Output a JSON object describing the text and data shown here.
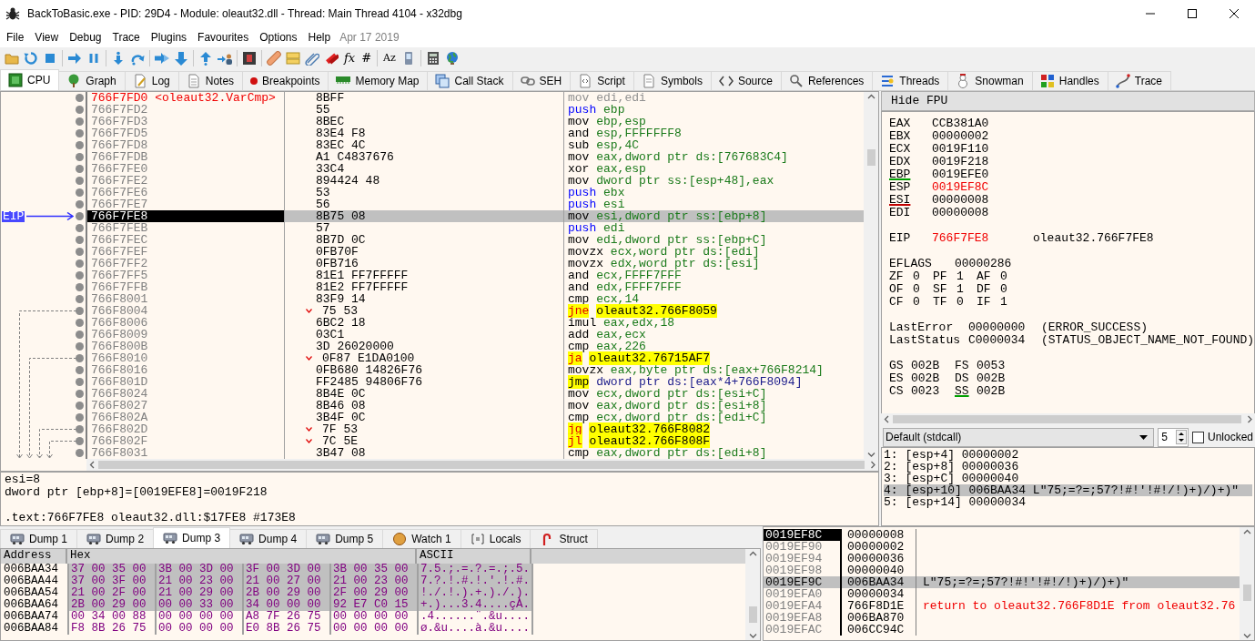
{
  "window": {
    "title": "BackToBasic.exe - PID: 29D4 - Module: oleaut32.dll - Thread: Main Thread 4104 - x32dbg"
  },
  "menu": {
    "items": [
      "File",
      "View",
      "Debug",
      "Trace",
      "Plugins",
      "Favourites",
      "Options",
      "Help"
    ],
    "build_date": "Apr 17 2019"
  },
  "toolbar": {
    "glyphs": [
      "fx",
      "#",
      "Az"
    ]
  },
  "tabs": [
    {
      "label": "CPU",
      "selected": true
    },
    {
      "label": "Graph",
      "selected": false
    },
    {
      "label": "Log",
      "selected": false
    },
    {
      "label": "Notes",
      "selected": false
    },
    {
      "label": "Breakpoints",
      "selected": false
    },
    {
      "label": "Memory Map",
      "selected": false
    },
    {
      "label": "Call Stack",
      "selected": false
    },
    {
      "label": "SEH",
      "selected": false
    },
    {
      "label": "Script",
      "selected": false
    },
    {
      "label": "Symbols",
      "selected": false
    },
    {
      "label": "Source",
      "selected": false
    },
    {
      "label": "References",
      "selected": false
    },
    {
      "label": "Threads",
      "selected": false
    },
    {
      "label": "Snowman",
      "selected": false
    },
    {
      "label": "Handles",
      "selected": false
    },
    {
      "label": "Trace",
      "selected": false
    }
  ],
  "disasm": {
    "eip_label": "EIP",
    "rows": [
      {
        "address": "766F7FD0",
        "label": "<oleaut32.VarCmp>",
        "bytes": "8BFF",
        "mnemonic": "mov",
        "operands": "edi,edi",
        "kind": "filler",
        "selected": false,
        "branch": false
      },
      {
        "address": "766F7FD2",
        "bytes": "55",
        "mnemonic": "push",
        "operands": "ebp",
        "kind": "push",
        "selected": false,
        "branch": false
      },
      {
        "address": "766F7FD3",
        "bytes": "8BEC",
        "mnemonic": "mov",
        "operands": "ebp,esp",
        "kind": "normal",
        "selected": false,
        "branch": false
      },
      {
        "address": "766F7FD5",
        "bytes": "83E4 F8",
        "mnemonic": "and",
        "operands": "esp,FFFFFFF8",
        "kind": "normal",
        "selected": false,
        "branch": false
      },
      {
        "address": "766F7FD8",
        "bytes": "83EC 4C",
        "mnemonic": "sub",
        "operands": "esp,4C",
        "kind": "normal",
        "selected": false,
        "branch": false
      },
      {
        "address": "766F7FDB",
        "bytes": "A1 C4837676",
        "mnemonic": "mov",
        "operands": "eax,dword ptr ds:[767683C4]",
        "kind": "normal",
        "selected": false,
        "branch": false
      },
      {
        "address": "766F7FE0",
        "bytes": "33C4",
        "mnemonic": "xor",
        "operands": "eax,esp",
        "kind": "normal",
        "selected": false,
        "branch": false
      },
      {
        "address": "766F7FE2",
        "bytes": "894424 48",
        "mnemonic": "mov",
        "operands": "dword ptr ss:[esp+48],eax",
        "kind": "normal",
        "selected": false,
        "branch": false
      },
      {
        "address": "766F7FE6",
        "bytes": "53",
        "mnemonic": "push",
        "operands": "ebx",
        "kind": "push",
        "selected": false,
        "branch": false
      },
      {
        "address": "766F7FE7",
        "bytes": "56",
        "mnemonic": "push",
        "operands": "esi",
        "kind": "push",
        "selected": false,
        "branch": false
      },
      {
        "address": "766F7FE8",
        "bytes": "8B75 08",
        "mnemonic": "mov",
        "operands": "esi,dword ptr ss:[ebp+8]",
        "kind": "normal",
        "selected": true,
        "branch": false
      },
      {
        "address": "766F7FEB",
        "bytes": "57",
        "mnemonic": "push",
        "operands": "edi",
        "kind": "push",
        "selected": false,
        "branch": false
      },
      {
        "address": "766F7FEC",
        "bytes": "8B7D 0C",
        "mnemonic": "mov",
        "operands": "edi,dword ptr ss:[ebp+C]",
        "kind": "normal",
        "selected": false,
        "branch": false
      },
      {
        "address": "766F7FEF",
        "bytes": "0FB70F",
        "mnemonic": "movzx",
        "operands": "ecx,word ptr ds:[edi]",
        "kind": "normal",
        "selected": false,
        "branch": false
      },
      {
        "address": "766F7FF2",
        "bytes": "0FB716",
        "mnemonic": "movzx",
        "operands": "edx,word ptr ds:[esi]",
        "kind": "normal",
        "selected": false,
        "branch": false
      },
      {
        "address": "766F7FF5",
        "bytes": "81E1 FF7FFFFF",
        "mnemonic": "and",
        "operands": "ecx,FFFF7FFF",
        "kind": "normal",
        "selected": false,
        "branch": false
      },
      {
        "address": "766F7FFB",
        "bytes": "81E2 FF7FFFFF",
        "mnemonic": "and",
        "operands": "edx,FFFF7FFF",
        "kind": "normal",
        "selected": false,
        "branch": false
      },
      {
        "address": "766F8001",
        "bytes": "83F9 14",
        "mnemonic": "cmp",
        "operands": "ecx,14",
        "kind": "normal",
        "selected": false,
        "branch": false
      },
      {
        "address": "766F8004",
        "bytes": "75 53",
        "mnemonic": "jne",
        "operands": "oleaut32.766F8059",
        "kind": "jump",
        "selected": false,
        "branch": true
      },
      {
        "address": "766F8006",
        "bytes": "6BC2 18",
        "mnemonic": "imul",
        "operands": "eax,edx,18",
        "kind": "normal",
        "selected": false,
        "branch": false
      },
      {
        "address": "766F8009",
        "bytes": "03C1",
        "mnemonic": "add",
        "operands": "eax,ecx",
        "kind": "normal",
        "selected": false,
        "branch": false
      },
      {
        "address": "766F800B",
        "bytes": "3D 26020000",
        "mnemonic": "cmp",
        "operands": "eax,226",
        "kind": "normal",
        "selected": false,
        "branch": false
      },
      {
        "address": "766F8010",
        "bytes": "0F87 E1DA0100",
        "mnemonic": "ja",
        "operands": "oleaut32.76715AF7",
        "kind": "jump",
        "selected": false,
        "branch": true
      },
      {
        "address": "766F8016",
        "bytes": "0FB680 14826F76",
        "mnemonic": "movzx",
        "operands": "eax,byte ptr ds:[eax+766F8214]",
        "kind": "normal",
        "selected": false,
        "branch": false
      },
      {
        "address": "766F801D",
        "bytes": "FF2485 94806F76",
        "mnemonic": "jmp",
        "operands": "dword ptr ds:[eax*4+766F8094]",
        "kind": "indirect",
        "selected": false,
        "branch": false
      },
      {
        "address": "766F8024",
        "bytes": "8B4E 0C",
        "mnemonic": "mov",
        "operands": "ecx,dword ptr ds:[esi+C]",
        "kind": "normal",
        "selected": false,
        "branch": false
      },
      {
        "address": "766F8027",
        "bytes": "8B46 08",
        "mnemonic": "mov",
        "operands": "eax,dword ptr ds:[esi+8]",
        "kind": "normal",
        "selected": false,
        "branch": false
      },
      {
        "address": "766F802A",
        "bytes": "3B4F 0C",
        "mnemonic": "cmp",
        "operands": "ecx,dword ptr ds:[edi+C]",
        "kind": "normal",
        "selected": false,
        "branch": false
      },
      {
        "address": "766F802D",
        "bytes": "7F 53",
        "mnemonic": "jg",
        "operands": "oleaut32.766F8082",
        "kind": "jump",
        "selected": false,
        "branch": true
      },
      {
        "address": "766F802F",
        "bytes": "7C 5E",
        "mnemonic": "jl",
        "operands": "oleaut32.766F808F",
        "kind": "jump",
        "selected": false,
        "branch": true
      },
      {
        "address": "766F8031",
        "bytes": "3B47 08",
        "mnemonic": "cmp",
        "operands": "eax,dword ptr ds:[edi+8]",
        "kind": "normal",
        "selected": false,
        "branch": false
      }
    ]
  },
  "info": [
    "esi=8",
    "dword ptr [ebp+8]=[0019EFE8]=0019F218",
    ".text:766F7FE8 oleaut32.dll:$17FE8 #173E8"
  ],
  "registers": {
    "hide_fpu": "Hide FPU",
    "general": [
      {
        "name": "EAX",
        "value": "CCB381A0",
        "changed": false
      },
      {
        "name": "EBX",
        "value": "00000002",
        "changed": false
      },
      {
        "name": "ECX",
        "value": "0019F110",
        "changed": false
      },
      {
        "name": "EDX",
        "value": "0019F218",
        "changed": false
      },
      {
        "name": "EBP",
        "value": "0019EFE0",
        "changed": false,
        "color": "#00a000"
      },
      {
        "name": "ESP",
        "value": "0019EF8C",
        "changed": true
      },
      {
        "name": "ESI",
        "value": "00000008",
        "changed": false,
        "color": "#c00000"
      },
      {
        "name": "EDI",
        "value": "00000008",
        "changed": false
      }
    ],
    "eip": {
      "name": "EIP",
      "value": "766F7FE8",
      "changed": true,
      "label": "oleaut32.766F7FE8"
    },
    "eflags": {
      "name": "EFLAGS",
      "value": "00000286"
    },
    "flags": [
      [
        {
          "name": "ZF",
          "value": "0"
        },
        {
          "name": "PF",
          "value": "1"
        },
        {
          "name": "AF",
          "value": "0"
        }
      ],
      [
        {
          "name": "OF",
          "value": "0"
        },
        {
          "name": "SF",
          "value": "1"
        },
        {
          "name": "DF",
          "value": "0"
        }
      ],
      [
        {
          "name": "CF",
          "value": "0"
        },
        {
          "name": "TF",
          "value": "0"
        },
        {
          "name": "IF",
          "value": "1"
        }
      ]
    ],
    "last": [
      {
        "name": "LastError",
        "value": "00000000",
        "note": "(ERROR_SUCCESS)"
      },
      {
        "name": "LastStatus",
        "value": "C0000034",
        "note": "(STATUS_OBJECT_NAME_NOT_FOUND)"
      }
    ],
    "segments": [
      [
        {
          "name": "GS",
          "value": "002B"
        },
        {
          "name": "FS",
          "value": "0053"
        }
      ],
      [
        {
          "name": "ES",
          "value": "002B"
        },
        {
          "name": "DS",
          "value": "002B"
        }
      ],
      [
        {
          "name": "CS",
          "value": "0023"
        },
        {
          "name": "SS",
          "value": "002B",
          "color": "#00a000"
        }
      ]
    ]
  },
  "callstack": {
    "convention": "Default (stdcall)",
    "count": "5",
    "unlocked": {
      "label": "Unlocked",
      "checked": false
    },
    "args": [
      {
        "text": "1: [esp+4] 00000002",
        "selected": false
      },
      {
        "text": "2: [esp+8] 00000036",
        "selected": false
      },
      {
        "text": "3: [esp+C] 00000040",
        "selected": false
      },
      {
        "text": "4: [esp+10] 006BAA34 L\"75;=?=;57?!#!'!#!/!)+)/)+)\"",
        "selected": true
      },
      {
        "text": "5: [esp+14] 00000034",
        "selected": false
      }
    ]
  },
  "dump": {
    "tabs": [
      {
        "label": "Dump 1",
        "selected": false
      },
      {
        "label": "Dump 2",
        "selected": false
      },
      {
        "label": "Dump 3",
        "selected": true
      },
      {
        "label": "Dump 4",
        "selected": false
      },
      {
        "label": "Dump 5",
        "selected": false
      },
      {
        "label": "Watch 1",
        "selected": false
      },
      {
        "label": "Locals",
        "selected": false
      },
      {
        "label": "Struct",
        "selected": false
      }
    ],
    "columns": [
      "Address",
      "Hex",
      "ASCII"
    ],
    "rows": [
      {
        "address": "006BAA34",
        "hex": [
          "37 00 35 00",
          "3B 00 3D 00",
          "3F 00 3D 00",
          "3B 00 35 00"
        ],
        "ascii": "7.5.;.=.?.=.;.5.",
        "selected": true
      },
      {
        "address": "006BAA44",
        "hex": [
          "37 00 3F 00",
          "21 00 23 00",
          "21 00 27 00",
          "21 00 23 00"
        ],
        "ascii": "7.?.!.#.!.'.!.#.",
        "selected": true
      },
      {
        "address": "006BAA54",
        "hex": [
          "21 00 2F 00",
          "21 00 29 00",
          "2B 00 29 00",
          "2F 00 29 00"
        ],
        "ascii": "!./.!.).+.)./.).",
        "selected": true
      },
      {
        "address": "006BAA64",
        "hex": [
          "2B 00 29 00",
          "00 00 33 00",
          "34 00 00 00",
          "92 E7 C0 15"
        ],
        "ascii": "+.)...3.4....çÀ.",
        "selected": true
      },
      {
        "address": "006BAA74",
        "hex": [
          "00 34 00 88",
          "00 00 00 00",
          "A8 7F 26 75",
          "00 00 00 00"
        ],
        "ascii": ".4......¨.&u....",
        "selected": false
      },
      {
        "address": "006BAA84",
        "hex": [
          "F8 8B 26 75",
          "00 00 00 00",
          "E0 8B 26 75",
          "00 00 00 00"
        ],
        "ascii": "ø.&u....à.&u....",
        "selected": false
      }
    ]
  },
  "stack": {
    "rows": [
      {
        "address": "0019EF8C",
        "value": "00000008",
        "current": true,
        "selected": false
      },
      {
        "address": "0019EF90",
        "value": "00000002",
        "current": false,
        "selected": false
      },
      {
        "address": "0019EF94",
        "value": "00000036",
        "current": false,
        "selected": false
      },
      {
        "address": "0019EF98",
        "value": "00000040",
        "current": false,
        "selected": false
      },
      {
        "address": "0019EF9C",
        "value": "006BAA34",
        "comment": "L\"75;=?=;57?!#!'!#!/!)+)/)+)\"",
        "kind": "string",
        "current": false,
        "selected": true
      },
      {
        "address": "0019EFA0",
        "value": "00000034",
        "current": false,
        "selected": false
      },
      {
        "address": "0019EFA4",
        "value": "766F8D1E",
        "comment": "return to oleaut32.766F8D1E from oleaut32.76",
        "kind": "return",
        "current": false,
        "selected": false
      },
      {
        "address": "0019EFA8",
        "value": "006BA870",
        "current": false,
        "selected": false
      },
      {
        "address": "0019EFAC",
        "value": "006CC94C",
        "current": false,
        "selected": false
      }
    ]
  }
}
